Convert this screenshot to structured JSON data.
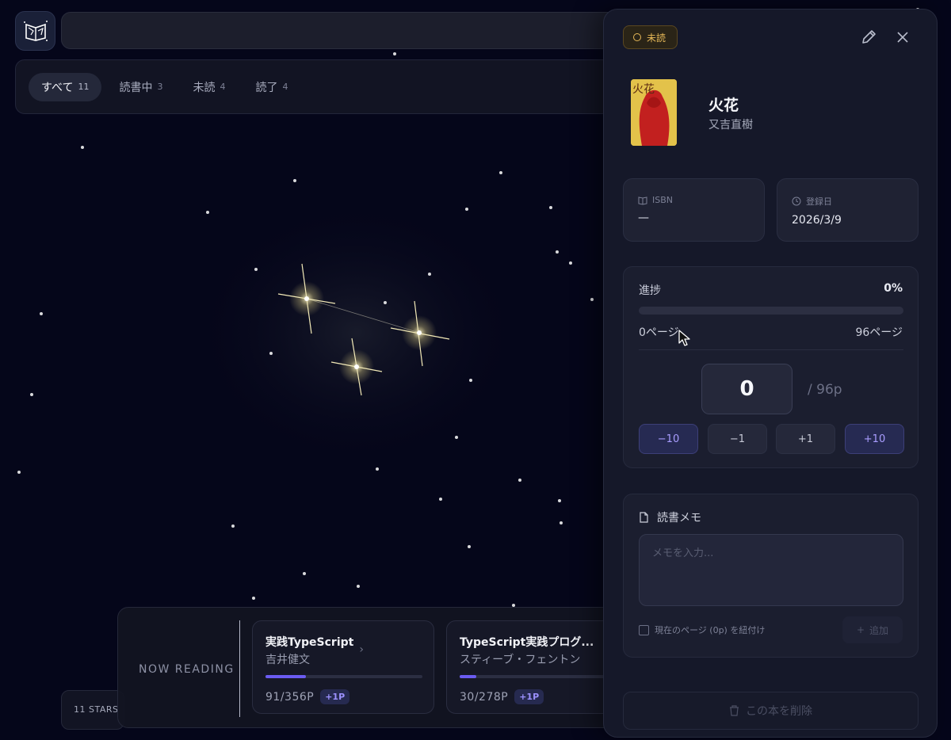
{
  "tabs": [
    {
      "label": "すべて",
      "count": "11"
    },
    {
      "label": "読書中",
      "count": "3"
    },
    {
      "label": "未読",
      "count": "4"
    },
    {
      "label": "読了",
      "count": "4"
    }
  ],
  "now_reading": {
    "label": "NOW READING",
    "books": [
      {
        "title": "実践TypeScript",
        "author": "吉井健文",
        "pages": "91/356P",
        "progress": 0.256,
        "plus": "+1P"
      },
      {
        "title": "TypeScript実践プログ...",
        "author": "スティーブ・フェントン",
        "pages": "30/278P",
        "progress": 0.108,
        "plus": "+1P"
      }
    ]
  },
  "stars_count": "11 STARS",
  "detail": {
    "status": "未読",
    "book_title": "火花",
    "author": "又吉直樹",
    "cover_text": "火花",
    "isbn_label": "ISBN",
    "isbn_value": "—",
    "date_label": "登録日",
    "date_value": "2026/3/9",
    "progress": {
      "label": "進捗",
      "percent": "0%",
      "fraction": 0,
      "min_label": "0ページ",
      "max_label": "96ページ",
      "current_page": "0",
      "total": "/ 96p",
      "buttons": [
        "−10",
        "−1",
        "+1",
        "+10"
      ]
    },
    "memo": {
      "title": "読書メモ",
      "placeholder": "メモを入力...",
      "attach_label": "現在のページ (0p) を紐付け",
      "add_label": "追加"
    },
    "delete_label": "この本を削除"
  },
  "colors": {
    "accent": "#6b5cf2",
    "status": "#e7b958",
    "background": "#05061a"
  }
}
